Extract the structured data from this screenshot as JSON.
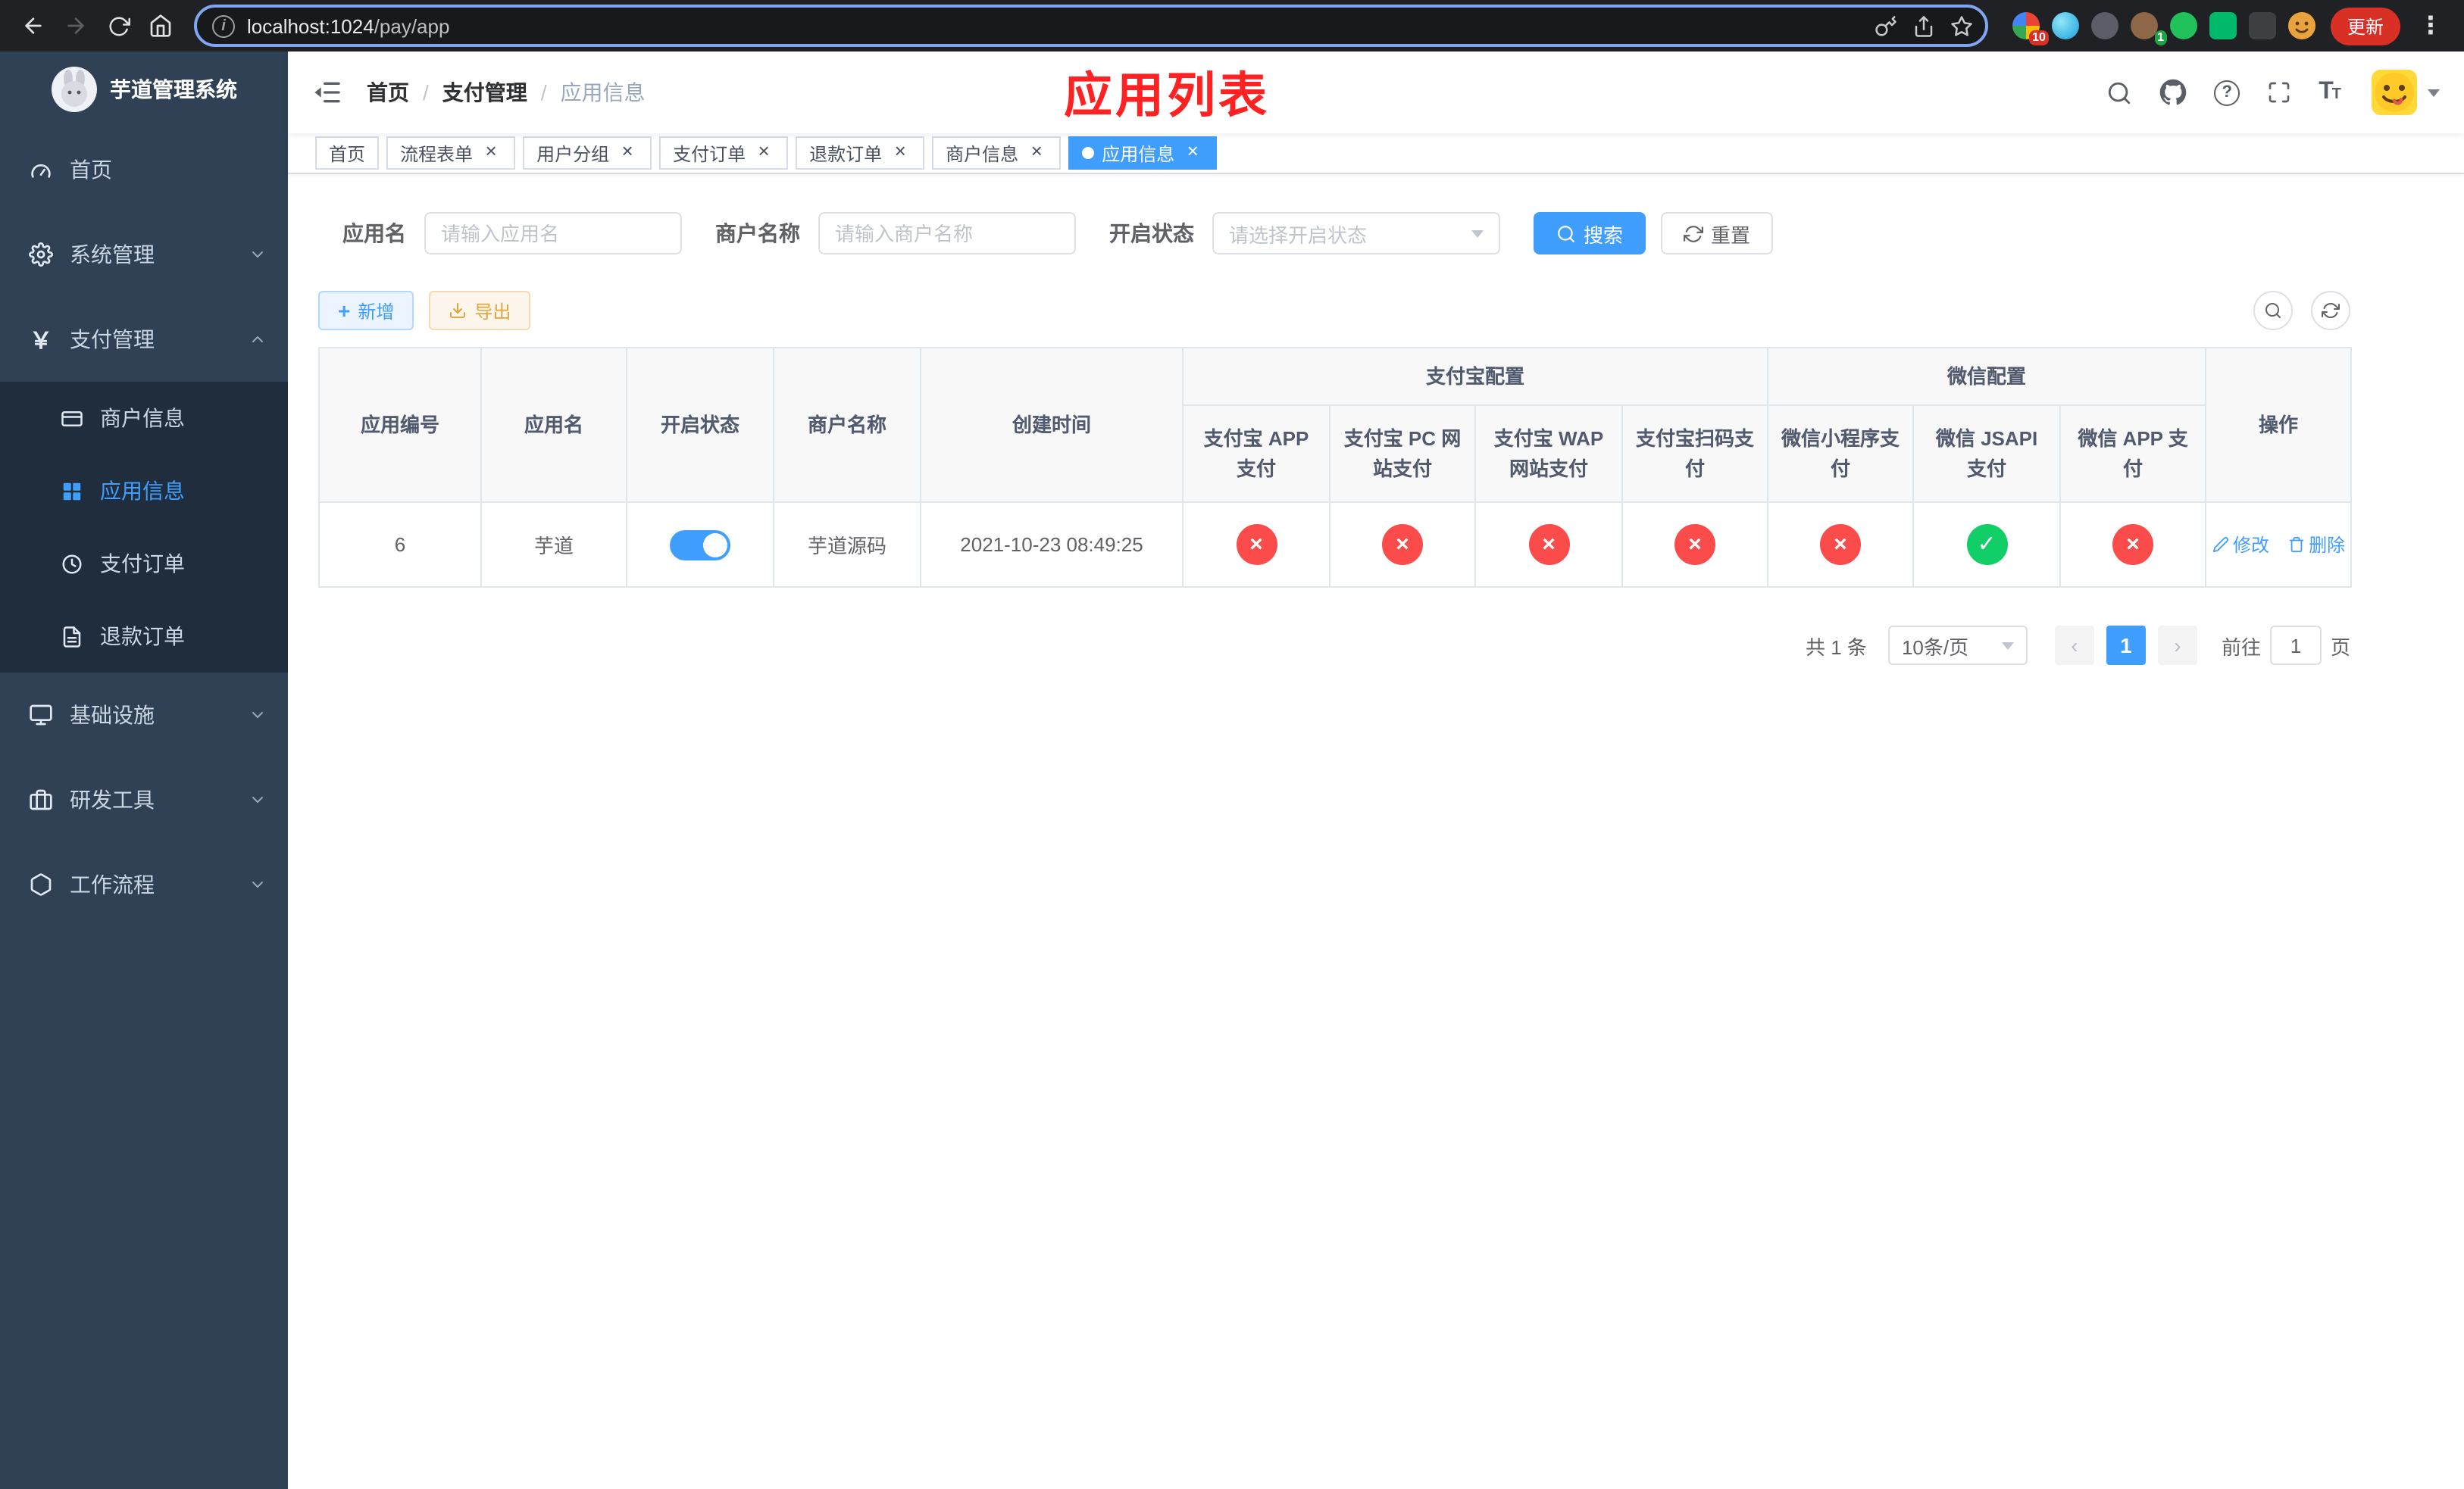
{
  "colors": {
    "accent": "#409eff",
    "danger_circle": "#fb4b4b",
    "success_circle": "#12ce66",
    "annotation_red": "#ff2222",
    "sidebar_bg": "#304156",
    "submenu_bg": "#1f2d3d"
  },
  "icons": {
    "close": "×",
    "plus": "+",
    "yen": "￥",
    "kebab": "⋮",
    "info": "i",
    "question": "?",
    "font_large": "T",
    "font_small": "T",
    "prev_arrow": "‹",
    "next_arrow": "›"
  },
  "browser": {
    "url_host": "localhost:1024",
    "url_path": "/pay/app",
    "update_label": "更新",
    "extension_badges": {
      "first": "10",
      "fourth": "1"
    }
  },
  "sidebar": {
    "title": "芋道管理系统",
    "items": [
      {
        "label": "首页"
      },
      {
        "label": "系统管理"
      },
      {
        "label": "支付管理"
      },
      {
        "label": "基础设施"
      },
      {
        "label": "研发工具"
      },
      {
        "label": "工作流程"
      }
    ],
    "payment_submenu": [
      {
        "label": "商户信息"
      },
      {
        "label": "应用信息"
      },
      {
        "label": "支付订单"
      },
      {
        "label": "退款订单"
      }
    ]
  },
  "navbar": {
    "breadcrumb": [
      {
        "label": "首页"
      },
      {
        "label": "支付管理"
      },
      {
        "label": "应用信息"
      }
    ],
    "annotation": "应用列表"
  },
  "tabs": [
    {
      "label": "首页"
    },
    {
      "label": "流程表单"
    },
    {
      "label": "用户分组"
    },
    {
      "label": "支付订单"
    },
    {
      "label": "退款订单"
    },
    {
      "label": "商户信息"
    },
    {
      "label": "应用信息"
    }
  ],
  "filters": {
    "app_name_label": "应用名",
    "app_name_placeholder": "请输入应用名",
    "merchant_label": "商户名称",
    "merchant_placeholder": "请输入商户名称",
    "status_label": "开启状态",
    "status_placeholder": "请选择开启状态",
    "search_label": "搜索",
    "reset_label": "重置"
  },
  "toolbar": {
    "add_label": "新增",
    "export_label": "导出"
  },
  "table": {
    "headers": {
      "app_id": "应用编号",
      "app_name": "应用名",
      "status": "开启状态",
      "merchant": "商户名称",
      "create_time": "创建时间",
      "alipay_group": "支付宝配置",
      "alipay_app": "支付宝 APP 支付",
      "alipay_pc": "支付宝 PC 网站支付",
      "alipay_wap": "支付宝 WAP 网站支付",
      "alipay_qr": "支付宝扫码支付",
      "wechat_group": "微信配置",
      "wechat_mini": "微信小程序支付",
      "wechat_jsapi": "微信 JSAPI 支付",
      "wechat_app": "微信 APP 支付",
      "actions": "操作"
    },
    "row": {
      "app_id": "6",
      "app_name": "芋道",
      "enabled": "on",
      "merchant": "芋道源码",
      "create_time": "2021-10-23 08:49:25",
      "channel_states": [
        {
          "state": "fail",
          "glyph": "×"
        },
        {
          "state": "fail",
          "glyph": "×"
        },
        {
          "state": "fail",
          "glyph": "×"
        },
        {
          "state": "fail",
          "glyph": "×"
        },
        {
          "state": "fail",
          "glyph": "×"
        },
        {
          "state": "pass",
          "glyph": "✓"
        },
        {
          "state": "fail",
          "glyph": "×"
        }
      ],
      "edit_label": "修改",
      "delete_label": "删除"
    }
  },
  "pagination": {
    "total_label": "共 1 条",
    "page_size": "10条/页",
    "current_page": "1",
    "goto_label": "前往",
    "goto_value": "1",
    "page_unit": "页"
  }
}
